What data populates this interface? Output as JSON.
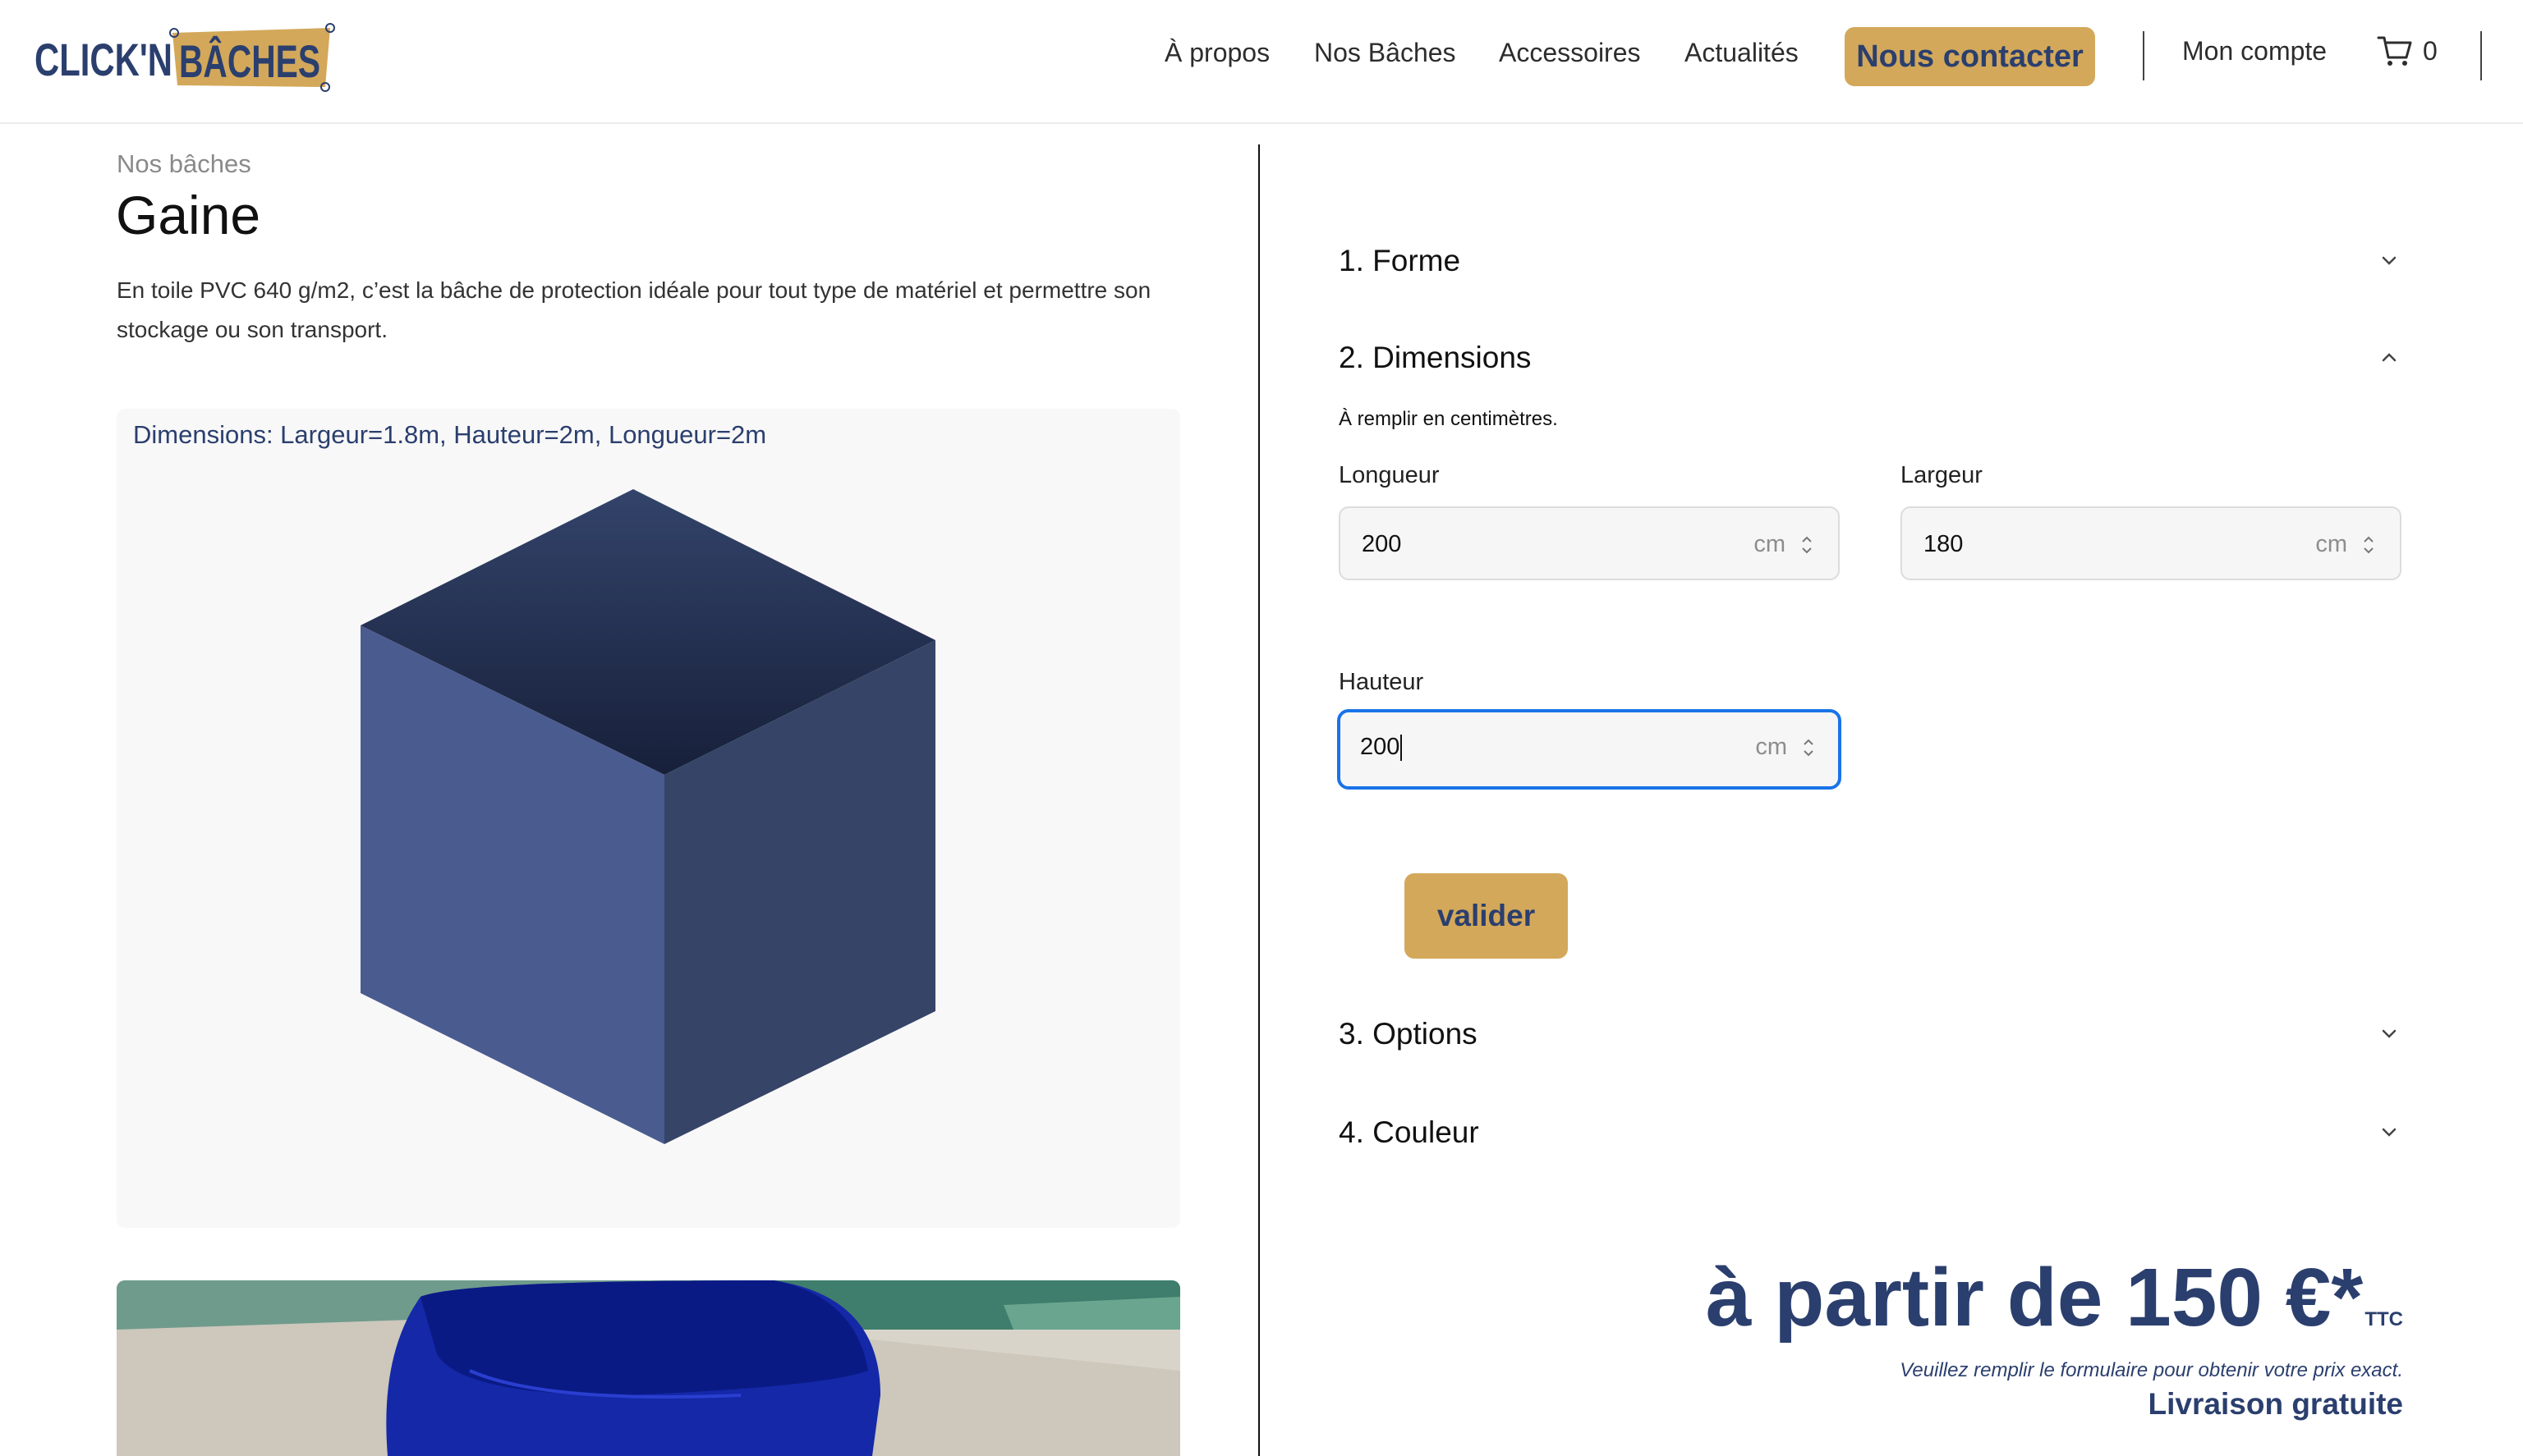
{
  "header": {
    "logo_text_left": "CLICK'N",
    "logo_text_right": "BÂCHES",
    "nav": [
      "À propos",
      "Nos Bâches",
      "Accessoires",
      "Actualités"
    ],
    "contact_label": "Nous contacter",
    "account_label": "Mon compte",
    "cart_count": "0"
  },
  "product": {
    "breadcrumb": "Nos bâches",
    "title": "Gaine",
    "description": "En toile PVC 640 g/m2, c’est la bâche de protection idéale pour tout type de matériel et permettre son stockage ou son transport.",
    "viewer_label": "Dimensions: Largeur=1.8m, Hauteur=2m, Longueur=2m"
  },
  "config": {
    "step1": "1. Forme",
    "step2": "2. Dimensions",
    "step2_hint": "À remplir en centimètres.",
    "fields": {
      "longueur": {
        "label": "Longueur",
        "value": "200",
        "unit": "cm"
      },
      "largeur": {
        "label": "Largeur",
        "value": "180",
        "unit": "cm"
      },
      "hauteur": {
        "label": "Hauteur",
        "value": "200",
        "unit": "cm"
      }
    },
    "validate_label": "valider",
    "step3": "3. Options",
    "step4": "4. Couleur"
  },
  "price": {
    "main": "à partir de 150 €*",
    "suffix": "TTC",
    "note": "Veuillez remplir le formulaire pour obtenir votre prix exact.",
    "delivery": "Livraison gratuite"
  },
  "colors": {
    "brand_navy": "#2b3f6e",
    "brand_gold": "#d3a85a",
    "focus_blue": "#1a73e8"
  }
}
